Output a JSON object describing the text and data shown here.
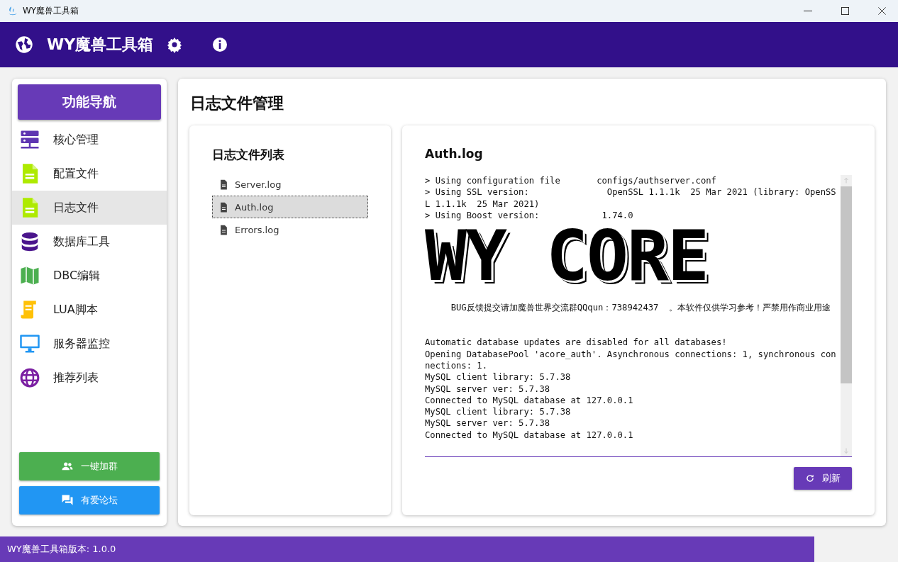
{
  "window": {
    "title": "WY魔兽工具箱"
  },
  "header": {
    "title": "WY魔兽工具箱"
  },
  "sidebar": {
    "heading": "功能导航",
    "items": [
      {
        "label": "核心管理",
        "kind": "server",
        "color": "#5e35b1",
        "selected": false
      },
      {
        "label": "配置文件",
        "kind": "doc",
        "color": "#aeea00",
        "selected": false
      },
      {
        "label": "日志文件",
        "kind": "doc",
        "color": "#aeea00",
        "selected": true
      },
      {
        "label": "数据库工具",
        "kind": "database",
        "color": "#4a148c",
        "selected": false
      },
      {
        "label": "DBC编辑",
        "kind": "map",
        "color": "#4caf50",
        "selected": false
      },
      {
        "label": "LUA脚本",
        "kind": "scroll",
        "color": "#ffc107",
        "selected": false
      },
      {
        "label": "服务器监控",
        "kind": "monitor",
        "color": "#2196f3",
        "selected": false
      },
      {
        "label": "推荐列表",
        "kind": "globe",
        "color": "#7b1fa2",
        "selected": false
      }
    ],
    "buttons": [
      {
        "label": "一键加群",
        "kind": "people",
        "color": "#4caf50"
      },
      {
        "label": "有爱论坛",
        "kind": "chat",
        "color": "#2196f3"
      }
    ]
  },
  "page": {
    "title": "日志文件管理"
  },
  "file_list": {
    "heading": "日志文件列表",
    "files": [
      {
        "name": "Server.log",
        "selected": false
      },
      {
        "name": "Auth.log",
        "selected": true
      },
      {
        "name": "Errors.log",
        "selected": false
      }
    ]
  },
  "log_view": {
    "title": "Auth.log",
    "lines": [
      {
        "kind": "text",
        "text": "> Using configuration file       configs/authserver.conf"
      },
      {
        "kind": "text",
        "text": "> Using SSL version:               OpenSSL 1.1.1k  25 Mar 2021 (library: OpenSSL 1.1.1k  25 Mar 2021)"
      },
      {
        "kind": "text",
        "text": "> Using Boost version:            1.74.0"
      },
      {
        "kind": "banner",
        "text": "WY CORE"
      },
      {
        "kind": "gap"
      },
      {
        "kind": "text",
        "text": "     BUG反馈提交请加魔兽世界交流群QQqun：738942437  。本软件仅供学习参考！严禁用作商业用途"
      },
      {
        "kind": "gap"
      },
      {
        "kind": "gap"
      },
      {
        "kind": "text",
        "text": "Automatic database updates are disabled for all databases!"
      },
      {
        "kind": "text",
        "text": "Opening DatabasePool 'acore_auth'. Asynchronous connections: 1, synchronous connections: 1."
      },
      {
        "kind": "text",
        "text": "MySQL client library: 5.7.38"
      },
      {
        "kind": "text",
        "text": "MySQL server ver: 5.7.38"
      },
      {
        "kind": "text",
        "text": "Connected to MySQL database at 127.0.0.1"
      },
      {
        "kind": "text",
        "text": "MySQL client library: 5.7.38"
      },
      {
        "kind": "text",
        "text": "MySQL server ver: 5.7.38"
      },
      {
        "kind": "text",
        "text": "Connected to MySQL database at 127.0.0.1"
      }
    ],
    "refresh_button": "刷新"
  },
  "status_bar": {
    "text": "WY魔兽工具箱版本: 1.0.0"
  }
}
